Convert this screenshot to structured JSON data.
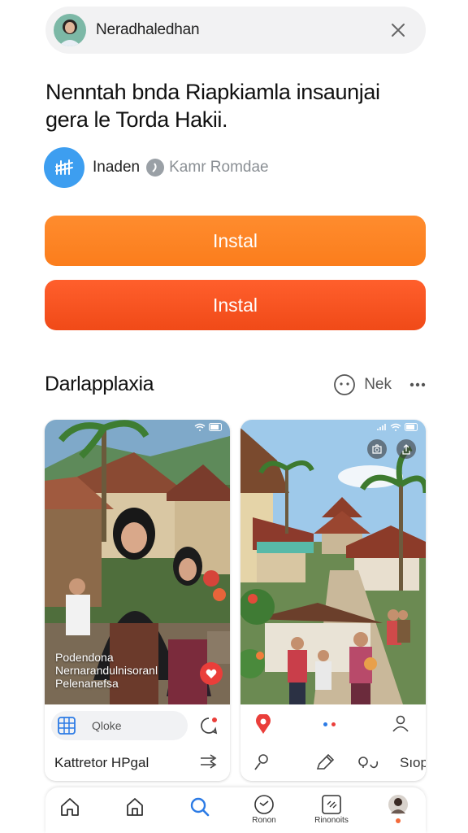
{
  "header": {
    "title": "Neradhaledhan"
  },
  "headline": {
    "line1": "Nenntah bnda Riapkiamla insaunjai",
    "line2": "gera le Torda Hakii."
  },
  "developer": {
    "name": "Inaden",
    "subtitle": "Kamr Romdae"
  },
  "buttons": {
    "primary": "Instal",
    "secondary": "Instal"
  },
  "section": {
    "title": "Darlapplaxia",
    "more_label": "Nek"
  },
  "cards": [
    {
      "overlay_lines": [
        "Podendona",
        "Nernarandulnisoranl",
        "Pelenanefsa"
      ],
      "chip_label": "Qloke",
      "footer_title": "Kattretor HPgal"
    },
    {
      "footer_label": "Sıop"
    }
  ],
  "bottom_nav": {
    "items": [
      {
        "label": ""
      },
      {
        "label": ""
      },
      {
        "label": ""
      },
      {
        "label": "Ronon"
      },
      {
        "label": "Rinonoits"
      },
      {
        "label": ""
      }
    ]
  },
  "colors": {
    "primary_button": "#fb7d1c",
    "secondary_button": "#f04a18",
    "accent_blue": "#2c7be5",
    "developer_logo": "#3d9ef0"
  }
}
